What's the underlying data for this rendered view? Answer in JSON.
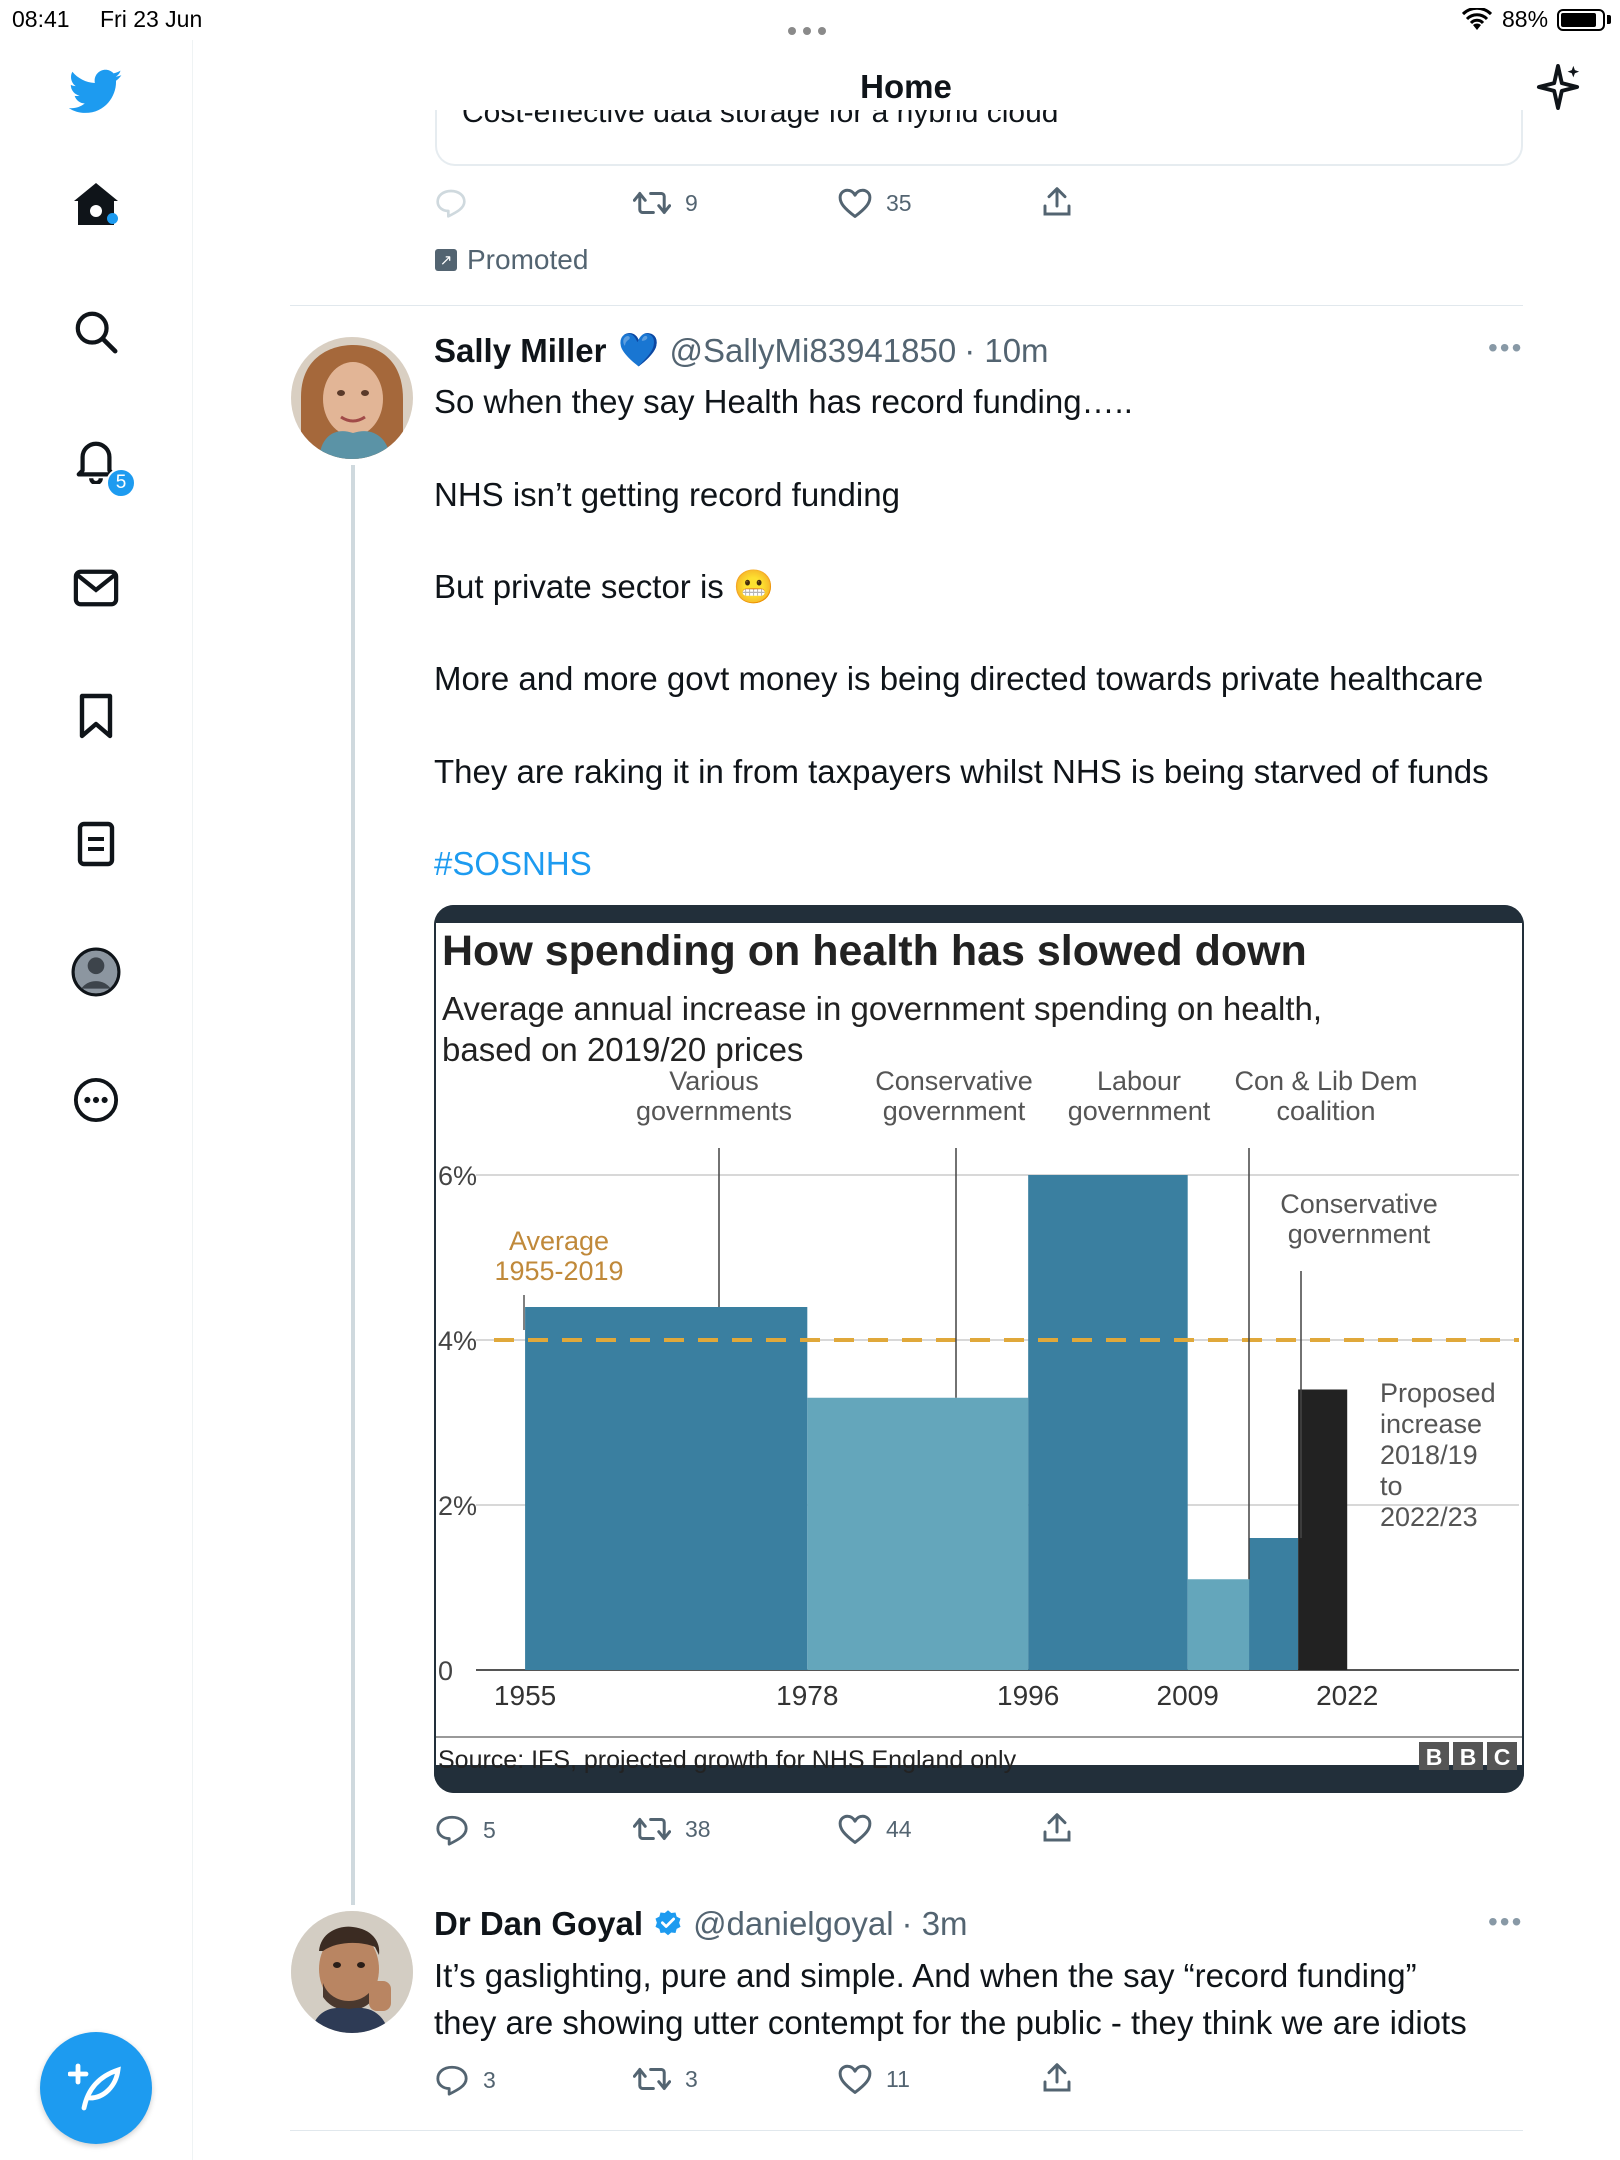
{
  "status": {
    "time": "08:41",
    "date": "Fri 23 Jun",
    "battery": "88%",
    "battery_level": 0.88
  },
  "header": {
    "title": "Home"
  },
  "nav": {
    "notifications_badge": "5"
  },
  "promoted_tweet": {
    "card_text": "Cost-effective data storage for a hybrid cloud",
    "actions": {
      "reply": "",
      "retweets": "9",
      "likes": "35"
    },
    "label": "Promoted"
  },
  "tweet1": {
    "name": "Sally Miller",
    "name_emoji": "💙",
    "handle": "@SallyMi83941850",
    "time": "· 10m",
    "lines": [
      "So when they say Health has record funding…..",
      "NHS isn’t getting record funding",
      "But private sector is 😬",
      "More and more govt money is being directed towards private healthcare",
      "They are raking it in from taxpayers whilst NHS is being starved of funds"
    ],
    "hashtag": "#SOSNHS",
    "actions": {
      "replies": "5",
      "retweets": "38",
      "likes": "44"
    }
  },
  "tweet2": {
    "name": "Dr Dan Goyal",
    "handle": "@danielgoyal",
    "time": "· 3m",
    "lines": [
      "It’s gaslighting, pure and simple. And when the say “record funding”",
      "they are showing utter contempt for the public - they think we are idiots"
    ],
    "actions": {
      "replies": "3",
      "retweets": "3",
      "likes": "11"
    }
  },
  "chart_data": {
    "type": "bar",
    "title": "How spending on health has slowed down",
    "subtitle_line1": "Average annual increase in government spending on health,",
    "subtitle_line2": "based on 2019/20 prices",
    "source": "Source: IFS, projected growth for NHS England only",
    "brand": [
      "B",
      "B",
      "C"
    ],
    "xlabel": "",
    "ylabel": "",
    "x_ticks": [
      "1955",
      "1978",
      "1996",
      "2009",
      "2022"
    ],
    "y_ticks": [
      "0",
      "2%",
      "4%",
      "6%"
    ],
    "ylim": [
      0,
      6
    ],
    "xlim": [
      1951,
      2036
    ],
    "bars": [
      {
        "start": 1955,
        "end": 1978,
        "value": 4.4,
        "color": "#3a7fa0"
      },
      {
        "start": 1978,
        "end": 1996,
        "value": 3.3,
        "color": "#64a6bb"
      },
      {
        "start": 1996,
        "end": 2009,
        "value": 6.0,
        "color": "#3a7fa0"
      },
      {
        "start": 2009,
        "end": 2014,
        "value": 1.1,
        "color": "#64a6bb"
      },
      {
        "start": 2014,
        "end": 2018,
        "value": 1.6,
        "color": "#3a7fa0"
      },
      {
        "start": 2018,
        "end": 2022,
        "value": 3.4,
        "color": "#222222"
      }
    ],
    "average": {
      "value": 4.0,
      "label_line1": "Average",
      "label_line2": "1955-2019",
      "color": "#e0a83a"
    },
    "annotations": [
      {
        "line1": "Various",
        "line2": "governments"
      },
      {
        "line1": "Conservative",
        "line2": "government"
      },
      {
        "line1": "Labour",
        "line2": "government"
      },
      {
        "line1": "Con & Lib Dem",
        "line2": "coalition"
      },
      {
        "line1": "Conservative",
        "line2": "government"
      }
    ],
    "proposed_label": [
      "Proposed",
      "increase",
      "2018/19",
      "to",
      "2022/23"
    ],
    "grid": true
  }
}
